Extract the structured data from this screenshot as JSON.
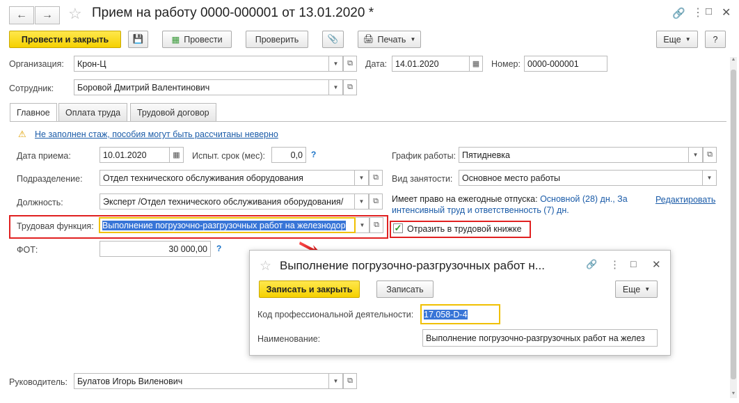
{
  "window": {
    "title": "Прием на работу 0000-000001 от 13.01.2020 *"
  },
  "toolbar": {
    "post_close": "Провести и закрыть",
    "post": "Провести",
    "check": "Проверить",
    "print": "Печать",
    "more": "Еще",
    "help": "?"
  },
  "header": {
    "org_label": "Организация:",
    "org_value": "Крон-Ц",
    "date_label": "Дата:",
    "date_value": "14.01.2020",
    "number_label": "Номер:",
    "number_value": "0000-000001",
    "employee_label": "Сотрудник:",
    "employee_value": "Боровой Дмитрий Валентинович"
  },
  "tabs": [
    "Главное",
    "Оплата труда",
    "Трудовой договор"
  ],
  "main": {
    "warning": "Не заполнен стаж, пособия могут быть рассчитаны неверно",
    "hire_date_label": "Дата приема:",
    "hire_date_value": "10.01.2020",
    "probation_label": "Испыт. срок (мес):",
    "probation_value": "0,0",
    "schedule_label": "График работы:",
    "schedule_value": "Пятидневка",
    "division_label": "Подразделение:",
    "division_value": "Отдел технического обслуживания оборудования",
    "employment_label": "Вид занятости:",
    "employment_value": "Основное место работы",
    "position_label": "Должность:",
    "position_value": "Эксперт /Отдел технического обслуживания оборудования/",
    "vacation_prefix": "Имеет право на ежегодные отпуска:",
    "vacation_line1": "Основной (28) дн., За",
    "vacation_line2": "интенсивный труд и ответственность (7) дн.",
    "edit_link": "Редактировать",
    "labor_func_label": "Трудовая функция:",
    "labor_func_value": "Выполнение погрузочно-разгрузочных работ на железнодор",
    "reflect_label": "Отразить в трудовой книжке",
    "reflect_checked": true,
    "fot_label": "ФОТ:",
    "fot_value": "30 000,00",
    "manager_label": "Руководитель:",
    "manager_value": "Булатов Игорь Виленович"
  },
  "popup": {
    "title": "Выполнение погрузочно-разгрузочных работ н...",
    "save_close": "Записать и закрыть",
    "save": "Записать",
    "more": "Еще",
    "code_label": "Код профессиональной деятельности:",
    "code_value": "17.058-D-4",
    "name_label": "Наименование:",
    "name_value": "Выполнение погрузочно-разгрузочных работ на желез"
  },
  "colors": {
    "accent_yellow": "#f5d000",
    "highlight_red": "#e02020",
    "link_blue": "#1a5ba8",
    "selection_blue": "#3875d7"
  }
}
